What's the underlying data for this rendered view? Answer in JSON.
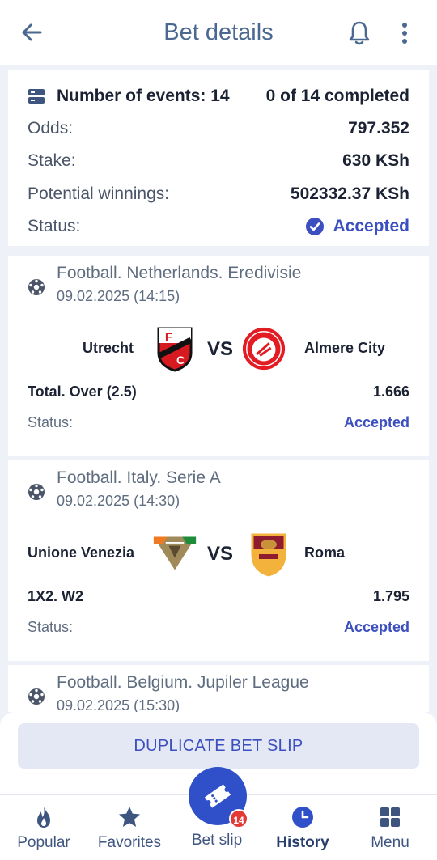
{
  "header": {
    "title": "Bet details"
  },
  "summary": {
    "events_label": "Number of events: 14",
    "completed": "0 of 14 completed",
    "odds_label": "Odds:",
    "odds_value": "797.352",
    "stake_label": "Stake:",
    "stake_value": "630 KSh",
    "winnings_label": "Potential winnings:",
    "winnings_value": "502332.37 KSh",
    "status_label": "Status:",
    "status_value": "Accepted"
  },
  "events": [
    {
      "league": "Football. Netherlands. Eredivisie",
      "date": "09.02.2025 (14:15)",
      "home": "Utrecht",
      "away": "Almere City",
      "vs": "VS",
      "market": "Total. Over (2.5)",
      "odds": "1.666",
      "status_label": "Status:",
      "status_value": "Accepted"
    },
    {
      "league": "Football. Italy. Serie A",
      "date": "09.02.2025 (14:30)",
      "home": "Unione Venezia",
      "away": "Roma",
      "vs": "VS",
      "market": "1X2. W2",
      "odds": "1.795",
      "status_label": "Status:",
      "status_value": "Accepted"
    },
    {
      "league": "Football. Belgium. Jupiler League",
      "date": "09.02.2025 (15:30)"
    }
  ],
  "duplicate_button": "DUPLICATE BET SLIP",
  "nav": {
    "popular": "Popular",
    "favorites": "Favorites",
    "betslip": "Bet slip",
    "betslip_badge": "14",
    "history": "History",
    "menu": "Menu"
  },
  "colors": {
    "accent": "#3b4fbf",
    "fab": "#2f50c8",
    "title": "#4b6891",
    "badge": "#e53935"
  }
}
